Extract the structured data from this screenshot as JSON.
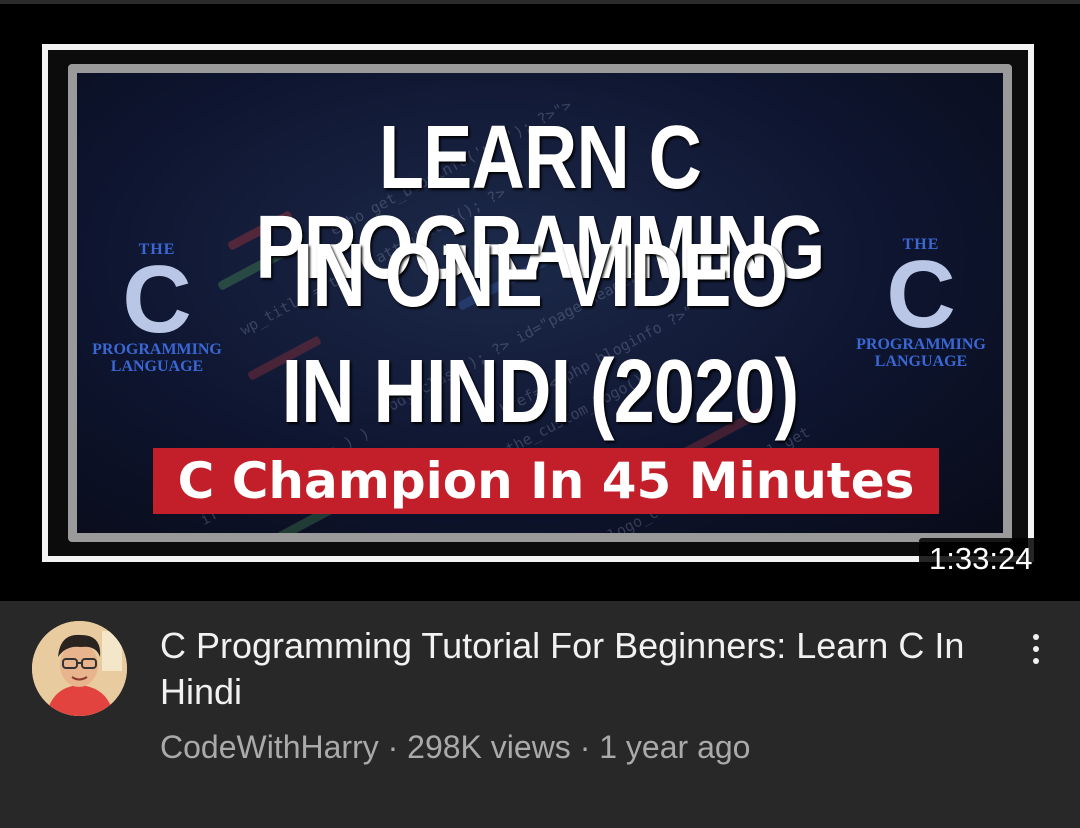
{
  "thumbnail": {
    "headline_line1": "LEARN C PROGRAMMING",
    "headline_line2": "IN ONE VIDEO",
    "headline_line3": "IN HINDI (2020)",
    "banner_text": "C Champion In 45 Minutes",
    "logo_left": {
      "top": "THE",
      "letter": "C",
      "line1": "PROGRAMMING",
      "line2": "LANGUAGE"
    },
    "logo_right": {
      "top": "THE",
      "letter": "C",
      "line1": "PROGRAMMING",
      "line2": "LANGUAGE"
    },
    "duration": "1:33:24"
  },
  "video": {
    "title": "C Programming Tutorial For Beginners: Learn C In Hindi",
    "channel": "CodeWithHarry",
    "views": "298K views",
    "age": "1 year ago",
    "separator": "·"
  },
  "icons": {
    "menu": "more-vert-icon",
    "avatar": "channel-avatar"
  },
  "colors": {
    "background": "#282828",
    "banner": "#c31f2a",
    "title": "#f1f1f1",
    "secondary": "#aaaaaa"
  }
}
